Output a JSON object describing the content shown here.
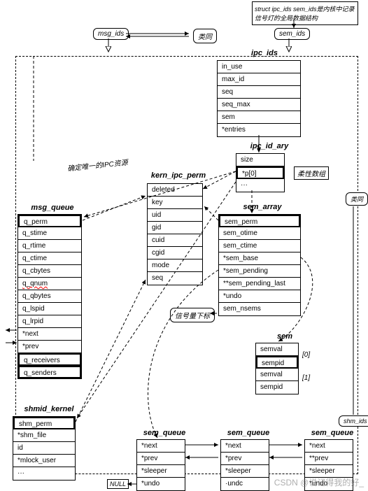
{
  "notes": {
    "top_note": "struct ipc_ids sem_ids是内核中记录信号灯的全局数据结构",
    "ipc_res": "确定唯一的IPC资源",
    "flex_arr": "柔性数组",
    "sem_index": "信号量下标",
    "same1": "类同",
    "same2": "类同"
  },
  "labels": {
    "msg_ids": "msg_ids",
    "sem_ids": "sem_ids",
    "shm_ids": "shm_ids",
    "null": "NULL"
  },
  "idx": {
    "i0": "[0]",
    "i1": "[1]"
  },
  "titles": {
    "ipc_ids": "ipc_ids",
    "ipc_id_ary": "ipc_id_ary",
    "kern_ipc_perm": "kern_ipc_perm",
    "msg_queue": "msg_queue",
    "sem_array": "sem_array",
    "sem": "sem",
    "shmid_kernel": "shmid_kernel",
    "sem_queue": "sem_queue"
  },
  "ipc_ids": {
    "f0": "in_use",
    "f1": "max_id",
    "f2": "seq",
    "f3": "seq_max",
    "f4": "sem",
    "f5": "*entries"
  },
  "ipc_id_ary": {
    "f0": "size",
    "f1": "*p[0]",
    "f2": "···"
  },
  "kern_ipc_perm": {
    "f0": "deleted",
    "f1": "key",
    "f2": "uid",
    "f3": "gid",
    "f4": "cuid",
    "f5": "cgid",
    "f6": "mode",
    "f7": "seq"
  },
  "msg_queue": {
    "f0": "q_perm",
    "f1": "q_stime",
    "f2": "q_rtime",
    "f3": "q_ctime",
    "f4": "q_cbytes",
    "f5": "q_qnum",
    "f6": "q_qbytes",
    "f7": "q_lspid",
    "f8": "q_lrpid",
    "f9": "*next",
    "f10": "*prev",
    "f11": "q_receivers",
    "f12": "q_senders"
  },
  "sem_array": {
    "f0": "sem_perm",
    "f1": "sem_otime",
    "f2": "sem_ctime",
    "f3": "*sem_base",
    "f4": "*sem_pending",
    "f5": "**sem_pending_last",
    "f6": "*undo",
    "f7": "sem_nsems"
  },
  "sem": {
    "f0": "semval",
    "f1": "sempid",
    "f2": "semval",
    "f3": "sempid"
  },
  "shmid_kernel": {
    "f0": "shm_perm",
    "f1": "*shm_file",
    "f2": "id",
    "f3": "*mlock_user",
    "f4": "···"
  },
  "sem_queue": {
    "f0": "*next",
    "f1": "*prev",
    "f2": "*sleeper",
    "f3": "*undo"
  },
  "sem_queue3": {
    "f0": "*next",
    "f1": "**prev",
    "f2": "*sleeper",
    "f3": "·undc"
  },
  "watermark": "CSDN @说记得我的好_"
}
